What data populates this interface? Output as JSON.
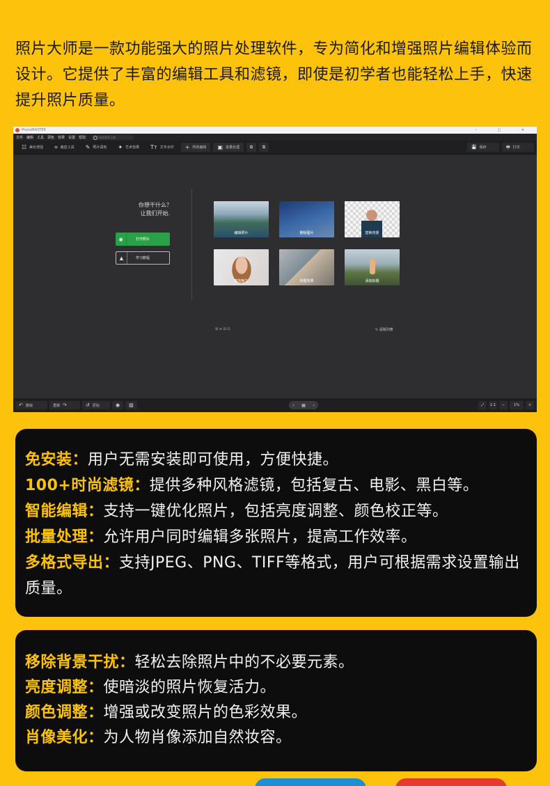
{
  "intro": {
    "text": "照片大师是一款功能强大的照片处理软件，专为简化和增强照片编辑体验而设计。它提供了丰富的编辑工具和滤镜，即使是初学者也能轻松上手，快速提升照片质量。"
  },
  "app": {
    "title": "PhotoMASTER",
    "window_controls": "– □ ×",
    "menu": [
      "文件",
      "编辑",
      "工具",
      "调色",
      "效果",
      "设置",
      "帮助"
    ],
    "search_placeholder": "搜索推荐主题",
    "toolbar": [
      {
        "icon": "☷",
        "label": "美化增强"
      },
      {
        "icon": "⌗",
        "label": "裁剪工具"
      },
      {
        "icon": "✎",
        "label": "照片润色"
      },
      {
        "icon": "✦",
        "label": "艺术效果"
      },
      {
        "icon": "Tт",
        "label": "文字水印"
      },
      {
        "icon": "+",
        "label": "所有编辑"
      },
      {
        "icon": "▣",
        "label": "批量处理"
      }
    ],
    "toolbar_right": [
      {
        "icon": "💾",
        "label": "保存"
      },
      {
        "icon": "🖶",
        "label": "打印"
      }
    ],
    "welcome": {
      "line1": "你想干什么？",
      "line2": "让我们开始."
    },
    "open_photo": "打开照片",
    "tutorial": "学习教程",
    "tiles": [
      {
        "label": "编辑照片"
      },
      {
        "label": "删除图片"
      },
      {
        "label": "替换背景"
      },
      {
        "label": "富有魅力"
      },
      {
        "label": "拼图效果"
      },
      {
        "label": "添加标题"
      }
    ],
    "canvas_options": "⊞ ≡ ⊟ ⊡",
    "clear_list": "↻ 清除列表",
    "bottom": {
      "undo": "撤销",
      "redo": "重做",
      "reset": "原始",
      "zoom_ratio": "1:1",
      "zoom_value": "1%"
    }
  },
  "features1": [
    {
      "key": "免安装：",
      "value": "用户无需安装即可使用，方便快捷。"
    },
    {
      "key": "100+时尚滤镜：",
      "value": "提供多种风格滤镜，包括复古、电影、黑白等。"
    },
    {
      "key": "智能编辑：",
      "value": "支持一键优化照片，包括亮度调整、颜色校正等。"
    },
    {
      "key": "批量处理：",
      "value": "允许用户同时编辑多张照片，提高工作效率。"
    },
    {
      "key": "多格式导出：",
      "value": "支持JPEG、PNG、TIFF等格式，用户可根据需求设置输出质量。"
    }
  ],
  "features2": [
    {
      "key": "移除背景干扰：",
      "value": "轻松去除照片中的不必要元素。"
    },
    {
      "key": "亮度调整：",
      "value": "使暗淡的照片恢复活力。"
    },
    {
      "key": "颜色调整：",
      "value": "增强或改变照片的色彩效果。"
    },
    {
      "key": "肖像美化：",
      "value": "为人物肖像添加自然妆容。"
    }
  ],
  "colors": {
    "background": "#fdc20b",
    "card": "#0d0d0d",
    "accent": "#fdc20b",
    "open_button": "#2aa148"
  }
}
